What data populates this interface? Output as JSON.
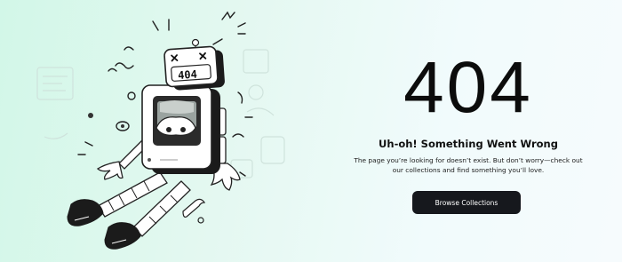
{
  "error": {
    "code": "404",
    "headline": "Uh-oh! Something Went Wrong",
    "message": "The page you’re looking for doesn’t exist. But don’t worry—check out our collections and find something you’ll love.",
    "cta_label": "Browse Collections"
  },
  "illustration": {
    "description_icon": "broken-robot-icon",
    "screen_text": "404"
  },
  "colors": {
    "background_start": "#d2f7e8",
    "background_end": "#f6fbfd",
    "button_bg": "#16181d",
    "button_text": "#ffffff",
    "text": "#0c0c0c"
  }
}
